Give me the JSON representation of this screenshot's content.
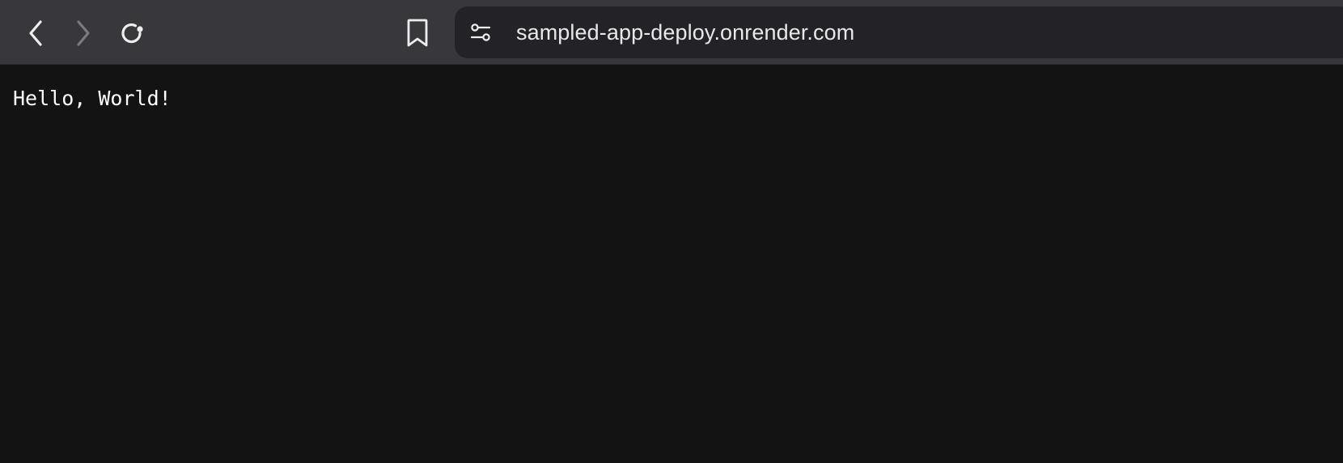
{
  "toolbar": {
    "back_icon": "chevron-left-icon",
    "forward_icon": "chevron-right-icon",
    "reload_icon": "reload-icon",
    "bookmark_icon": "bookmark-icon",
    "forward_enabled": false
  },
  "address_bar": {
    "site_settings_icon": "sliders-icon",
    "url": "sampled-app-deploy.onrender.com"
  },
  "page": {
    "body_text": "Hello, World!"
  },
  "colors": {
    "toolbar_bg": "#38373c",
    "address_bar_bg": "#232227",
    "page_bg": "#131313",
    "text": "#ffffff"
  }
}
